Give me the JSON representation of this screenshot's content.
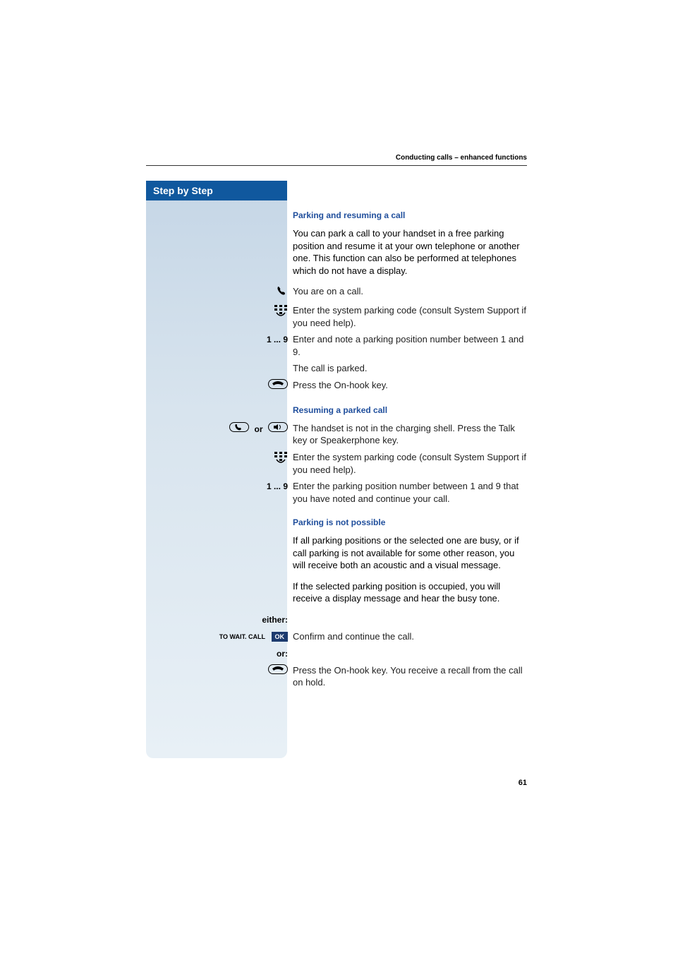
{
  "header": {
    "section": "Conducting calls – enhanced functions"
  },
  "sidebar": {
    "title": "Step by Step"
  },
  "sections": {
    "parking": {
      "heading": "Parking and resuming a call",
      "intro": "You can park a call to your handset in a free parking position and resume it at your own telephone or another one. This function can also be performed at telephones which do not have a display.",
      "step1_text": "You are on a call.",
      "step2_text": "Enter the system parking code (consult System Support if you need help).",
      "step3_label": "1 ... 9",
      "step3_text": "Enter and note a parking position number between 1 and 9.",
      "step4_text": "The call is parked.",
      "step5_text": "Press the On-hook key."
    },
    "resuming": {
      "heading": "Resuming a parked call",
      "or_word": "or",
      "step1_text": "The handset is not in the charging shell. Press the Talk key or Speakerphone key.",
      "step2_text": "Enter the system parking code (consult System Support if you need help).",
      "step3_label": "1 ... 9",
      "step3_text": "Enter the parking position number between 1 and 9 that you have noted and continue your call."
    },
    "notpossible": {
      "heading": "Parking is not possible",
      "para1": "If all parking positions or the selected one are busy, or if call parking is not available for some other reason, you will receive both an acoustic and a visual message.",
      "para2": "If the selected parking position is occupied, you will receive a display message and hear the busy tone.",
      "either_label": "either:",
      "wait_label": "TO WAIT. CALL",
      "ok_label": "OK",
      "wait_text": "Confirm and continue the call.",
      "or_label": "or:",
      "onhook_text": "Press the On-hook key. You receive a recall from the call on hold."
    }
  },
  "page_number": "61"
}
